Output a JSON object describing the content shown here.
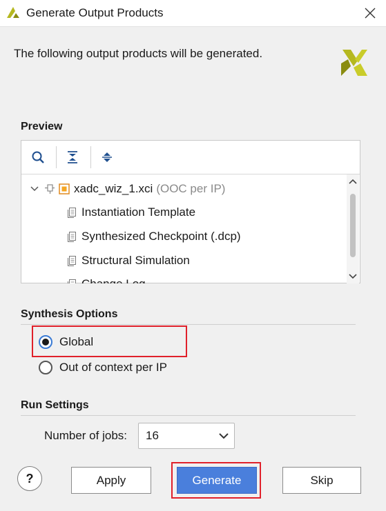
{
  "window": {
    "title": "Generate Output Products",
    "close_icon": "close-icon"
  },
  "intro": "The following output products will be generated.",
  "preview": {
    "title": "Preview",
    "toolbar": [
      "search-icon",
      "collapse-all-icon",
      "expand-all-icon"
    ],
    "tree": {
      "root": {
        "name": "xadc_wiz_1.xci",
        "note": "(OOC per IP)"
      },
      "children": [
        "Instantiation Template",
        "Synthesized Checkpoint (.dcp)",
        "Structural Simulation",
        "Change Log"
      ]
    }
  },
  "synthesis": {
    "title": "Synthesis Options",
    "options": [
      {
        "label": "Global",
        "selected": true
      },
      {
        "label": "Out of context per IP",
        "selected": false
      }
    ]
  },
  "run_settings": {
    "title": "Run Settings",
    "jobs_label": "Number of jobs:",
    "jobs_value": "16"
  },
  "buttons": {
    "help": "?",
    "apply": "Apply",
    "generate": "Generate",
    "skip": "Skip"
  },
  "colors": {
    "accent": "#4a7fdc",
    "highlight": "#e0202a",
    "logo": "#b5b820"
  }
}
